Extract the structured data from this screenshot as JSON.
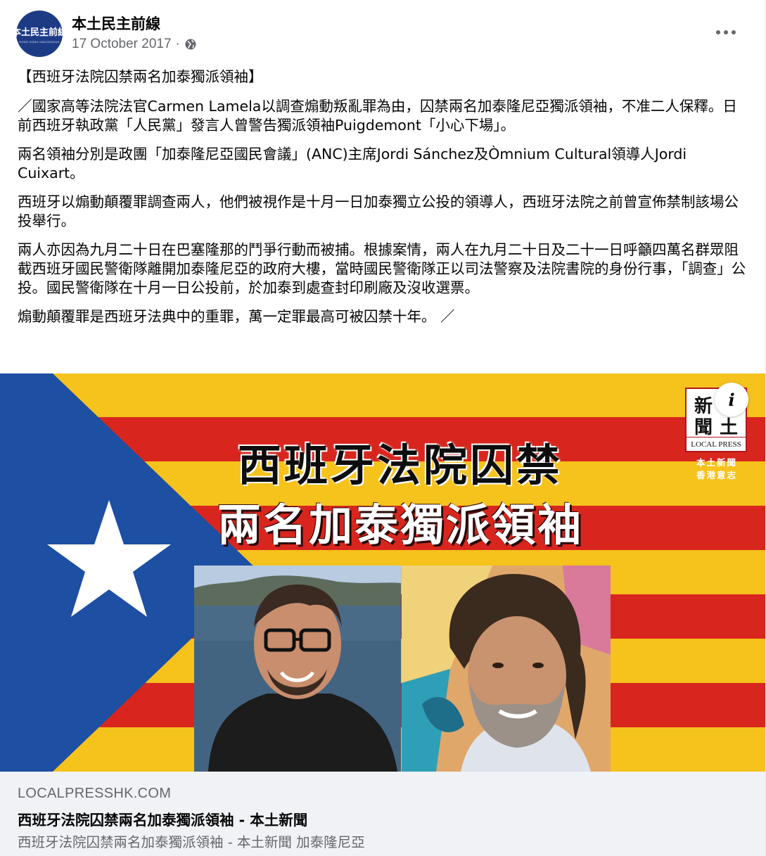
{
  "post": {
    "page_name": "本土民主前線",
    "date": "17 October 2017",
    "separator": "·",
    "privacy_icon": "globe-icon",
    "avatar_logo_text": "本土民主前線",
    "avatar_logo_subtext": "HONG KONG INDIGENOUS",
    "paragraphs": [
      "【西班牙法院囚禁兩名加泰獨派領袖】",
      "／國家高等法院法官Carmen Lamela以調查煽動叛亂罪為由，囚禁兩名加泰隆尼亞獨派領袖，不准二人保釋。日前西班牙執政黨「人民黨」發言人曾警告獨派領袖Puigdemont「小心下場」。",
      "兩名領袖分別是政團「加泰隆尼亞國民會議」(ANC)主席Jordi Sánchez及Òmnium Cultural領導人Jordi Cuixart。",
      "西班牙以煽動顛覆罪調查兩人，他們被視作是十月一日加泰獨立公投的領導人，西班牙法院之前曾宣佈禁制該場公投舉行。",
      "兩人亦因為九月二十日在巴塞隆那的鬥爭行動而被捕。根據案情，兩人在九月二十日及二十一日呼籲四萬名群眾阻截西班牙國民警衛隊離開加泰隆尼亞的政府大樓，當時國民警衛隊正以司法警察及法院書院的身份行事，「調查」公投。國民警衛隊在十月一日公投前，於加泰到處查封印刷廠及沒收選票。",
      "煽動顛覆罪是西班牙法典中的重罪，萬一定罪最高可被囚禁十年。 ／"
    ]
  },
  "preview_image": {
    "title_line1": "西班牙法院囚禁",
    "title_line2": "兩名加泰獨派領袖",
    "logo_chars": [
      "新",
      "本",
      "聞",
      "土"
    ],
    "logo_en": "LOCAL PRESS",
    "logo_sub1": "本土新聞",
    "logo_sub2": "香港意志",
    "info_label": "i",
    "colors": {
      "flag_yellow": "#f6c21c",
      "flag_red": "#d8261e",
      "flag_blue": "#1d4fa3",
      "star": "#ffffff"
    }
  },
  "link": {
    "domain": "LOCALPRESSHK.COM",
    "title": "西班牙法院囚禁兩名加泰獨派領袖 - 本土新聞",
    "description": "西班牙法院囚禁兩名加泰獨派領袖 - 本土新聞 加泰隆尼亞"
  }
}
